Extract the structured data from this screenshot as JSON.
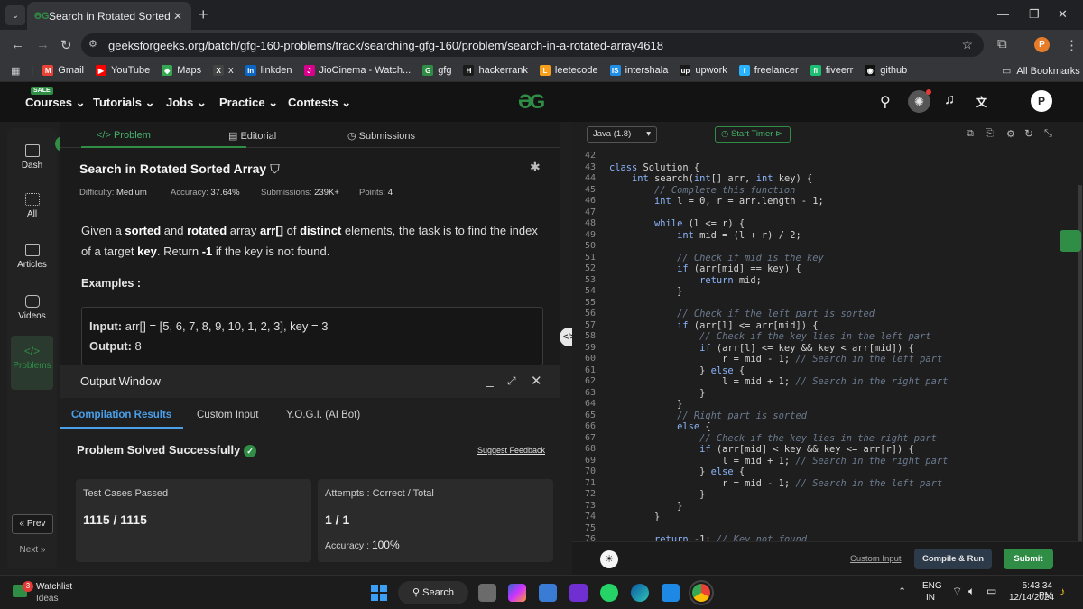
{
  "browser": {
    "tab_title": "Search in Rotated Sorted Array",
    "tab_favicon": "gfg",
    "url": "geeksforgeeks.org/batch/gfg-160-problems/track/searching-gfg-160/problem/search-in-a-rotated-array4618",
    "profile_initial": "P",
    "all_bookmarks": "All Bookmarks",
    "bookmarks": [
      {
        "label": "Gmail",
        "color": "#ea4335",
        "glyph": "M"
      },
      {
        "label": "YouTube",
        "color": "#ff0000",
        "glyph": "▶"
      },
      {
        "label": "Maps",
        "color": "#34a853",
        "glyph": "◆"
      },
      {
        "label": "x",
        "color": "#444444",
        "glyph": "X"
      },
      {
        "label": "linkden",
        "color": "#0a66c2",
        "glyph": "in"
      },
      {
        "label": "JioCinema - Watch...",
        "color": "#d9008d",
        "glyph": "J"
      },
      {
        "label": "gfg",
        "color": "#2f8d46",
        "glyph": "G"
      },
      {
        "label": "hackerrank",
        "color": "#1a1a1a",
        "glyph": "H"
      },
      {
        "label": "leetecode",
        "color": "#f89f1b",
        "glyph": "L"
      },
      {
        "label": "intershala",
        "color": "#1f8ee6",
        "glyph": "IS"
      },
      {
        "label": "upwork",
        "color": "#1a1a1a",
        "glyph": "up"
      },
      {
        "label": "freelancer",
        "color": "#29b2fe",
        "glyph": "f"
      },
      {
        "label": "fiveerr",
        "color": "#1dbf73",
        "glyph": "fi"
      },
      {
        "label": "github",
        "color": "#111111",
        "glyph": "◉"
      }
    ]
  },
  "site_nav": {
    "sale_badge": "SALE",
    "items": [
      "Courses",
      "Tutorials",
      "Jobs",
      "Practice",
      "Contests"
    ],
    "logo": "ƏG",
    "avatar": "P"
  },
  "sidebar": {
    "items": [
      "Dash",
      "All",
      "Articles",
      "Videos",
      "Problems"
    ],
    "prev": "« Prev",
    "next": "Next »"
  },
  "problem": {
    "tabs": [
      "Problem",
      "Editorial",
      "Submissions"
    ],
    "title": "Search in Rotated Sorted Array",
    "difficulty_label": "Difficulty:",
    "difficulty": "Medium",
    "accuracy_label": "Accuracy:",
    "accuracy": "37.64%",
    "submissions_label": "Submissions:",
    "submissions": "239K+",
    "points_label": "Points:",
    "points": "4",
    "desc_1": "Given a ",
    "desc_b1": "sorted",
    "desc_2": " and ",
    "desc_b2": "rotated",
    "desc_3": " array ",
    "desc_b3": "arr[]",
    "desc_4": " of ",
    "desc_b4": "distinct",
    "desc_5": " elements, the task is to find the index of a target ",
    "desc_b5": "key",
    "desc_6": ". Return ",
    "desc_b6": "-1",
    "desc_7": " if the key is not found.",
    "examples_label": "Examples :",
    "ex_input_label": "Input:",
    "ex_input": "arr[] = [5, 6, 7, 8, 9, 10, 1, 2, 3], key = 3",
    "ex_output_label": "Output:",
    "ex_output": "8"
  },
  "output_window": {
    "title": "Output Window",
    "tabs": [
      "Compilation Results",
      "Custom Input",
      "Y.O.G.I. (AI Bot)"
    ],
    "status": "Problem Solved Successfully",
    "suggest": "Suggest Feedback",
    "test_cases_label": "Test Cases Passed",
    "test_cases": "1115 / 1115",
    "attempts_label": "Attempts : Correct / Total",
    "attempts": "1 / 1",
    "accuracy_label": "Accuracy :",
    "accuracy": "100%"
  },
  "editor": {
    "language": "Java (1.8)",
    "timer": "Start Timer",
    "custom_input": "Custom Input",
    "compile": "Compile & Run",
    "submit": "Submit",
    "lines": [
      {
        "n": "42",
        "t": ""
      },
      {
        "n": "43",
        "t": "class Solution {"
      },
      {
        "n": "44",
        "t": "    int search(int[] arr, int key) {"
      },
      {
        "n": "45",
        "t": "        // Complete this function",
        "c": true
      },
      {
        "n": "46",
        "t": "        int l = 0, r = arr.length - 1;"
      },
      {
        "n": "47",
        "t": ""
      },
      {
        "n": "48",
        "t": "        while (l <= r) {"
      },
      {
        "n": "49",
        "t": "            int mid = (l + r) / 2;"
      },
      {
        "n": "50",
        "t": ""
      },
      {
        "n": "51",
        "t": "            // Check if mid is the key",
        "c": true
      },
      {
        "n": "52",
        "t": "            if (arr[mid] == key) {"
      },
      {
        "n": "53",
        "t": "                return mid;"
      },
      {
        "n": "54",
        "t": "            }"
      },
      {
        "n": "55",
        "t": ""
      },
      {
        "n": "56",
        "t": "            // Check if the left part is sorted",
        "c": true
      },
      {
        "n": "57",
        "t": "            if (arr[l] <= arr[mid]) {"
      },
      {
        "n": "58",
        "t": "                // Check if the key lies in the left part",
        "c": true
      },
      {
        "n": "59",
        "t": "                if (arr[l] <= key && key < arr[mid]) {"
      },
      {
        "n": "60",
        "t": "                    r = mid - 1; // Search in the left part"
      },
      {
        "n": "61",
        "t": "                } else {"
      },
      {
        "n": "62",
        "t": "                    l = mid + 1; // Search in the right part"
      },
      {
        "n": "63",
        "t": "                }"
      },
      {
        "n": "64",
        "t": "            }"
      },
      {
        "n": "65",
        "t": "            // Right part is sorted",
        "c": true
      },
      {
        "n": "66",
        "t": "            else {"
      },
      {
        "n": "67",
        "t": "                // Check if the key lies in the right part",
        "c": true
      },
      {
        "n": "68",
        "t": "                if (arr[mid] < key && key <= arr[r]) {"
      },
      {
        "n": "69",
        "t": "                    l = mid + 1; // Search in the right part"
      },
      {
        "n": "70",
        "t": "                } else {"
      },
      {
        "n": "71",
        "t": "                    r = mid - 1; // Search in the left part"
      },
      {
        "n": "72",
        "t": "                }"
      },
      {
        "n": "73",
        "t": "            }"
      },
      {
        "n": "74",
        "t": "        }"
      },
      {
        "n": "75",
        "t": ""
      },
      {
        "n": "76",
        "t": "        return -1; // Key not found"
      }
    ]
  },
  "taskbar": {
    "watchlist_badge": "3",
    "watchlist": "Watchlist",
    "watchlist_sub": "Ideas",
    "search": "Search",
    "lang": "ENG",
    "region": "IN",
    "time": "5:43:34 PM",
    "date": "12/14/2024"
  },
  "colors": {
    "accent_green": "#2f8d46",
    "link_blue": "#4a9fe8"
  }
}
